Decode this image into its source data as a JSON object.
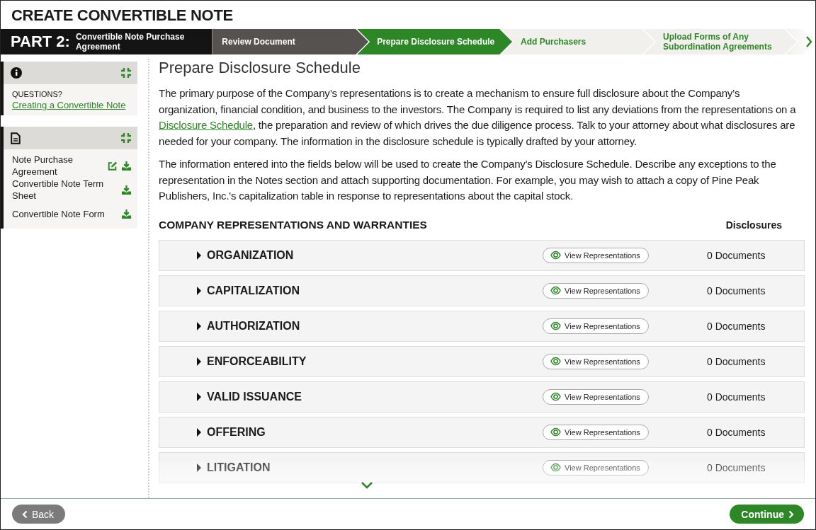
{
  "title": "CREATE CONVERTIBLE NOTE",
  "part": {
    "label": "PART 2:",
    "name": "Convertible Note Purchase Agreement"
  },
  "steps": [
    {
      "label": "Review Document",
      "completed": true,
      "selected": false
    },
    {
      "label": "Prepare Disclosure Schedule",
      "completed": false,
      "selected": true
    },
    {
      "label": "Add Purchasers",
      "completed": false,
      "selected": false
    },
    {
      "label": "Upload Forms of Any Subordination Agreements",
      "completed": false,
      "selected": false
    }
  ],
  "help_panel": {
    "heading": "QUESTIONS?",
    "link": "Creating a Convertible Note",
    "expanded": true
  },
  "documents_panel": {
    "expanded": true,
    "items": [
      {
        "name": "Note Purchase Agreement",
        "editable": true
      },
      {
        "name": "Convertible Note Term Sheet",
        "editable": false
      },
      {
        "name": "Convertible Note Form",
        "editable": false
      }
    ]
  },
  "page_title": "Prepare Disclosure Schedule",
  "paragraphs": [
    {
      "before": "The primary purpose of the Company’s representations is to create a mechanism to ensure full disclosure about the Company’s organization, financial condition, and business to the investors. The Company is required to list any deviations from the representations on a ",
      "link": "Disclosure Schedule",
      "after": ", the preparation and review of which drives the due diligence process. Talk to your attorney about what disclosures are needed for your company. The information in the disclosure schedule is typically drafted by your attorney."
    },
    {
      "before": "The information entered into the fields below will be used to create the Company's Disclosure Schedule. Describe any exceptions to the representation in the Notes section and attach supporting documentation. For example, you may wish to attach a copy of Pine Peak Publishers, Inc.'s capitalization table in response to representations about the capital stock."
    }
  ],
  "section": {
    "heading": "COMPANY REPRESENTATIONS AND WARRANTIES",
    "column_heading": "Disclosures"
  },
  "sections": [
    {
      "name": "ORGANIZATION",
      "button": "View Representations",
      "disclosures": "0 Documents",
      "expanded": false
    },
    {
      "name": "CAPITALIZATION",
      "button": "View Representations",
      "disclosures": "0 Documents",
      "expanded": false
    },
    {
      "name": "AUTHORIZATION",
      "button": "View Representations",
      "disclosures": "0 Documents",
      "expanded": false
    },
    {
      "name": "ENFORCEABILITY",
      "button": "View Representations",
      "disclosures": "0 Documents",
      "expanded": false
    },
    {
      "name": "VALID ISSUANCE",
      "button": "View Representations",
      "disclosures": "0 Documents",
      "expanded": false
    },
    {
      "name": "OFFERING",
      "button": "View Representations",
      "disclosures": "0 Documents",
      "expanded": false
    },
    {
      "name": "LITIGATION",
      "button": "View Representations",
      "disclosures": "0 Documents",
      "expanded": false
    }
  ],
  "footer": {
    "back": "Back",
    "continue": "Continue"
  }
}
